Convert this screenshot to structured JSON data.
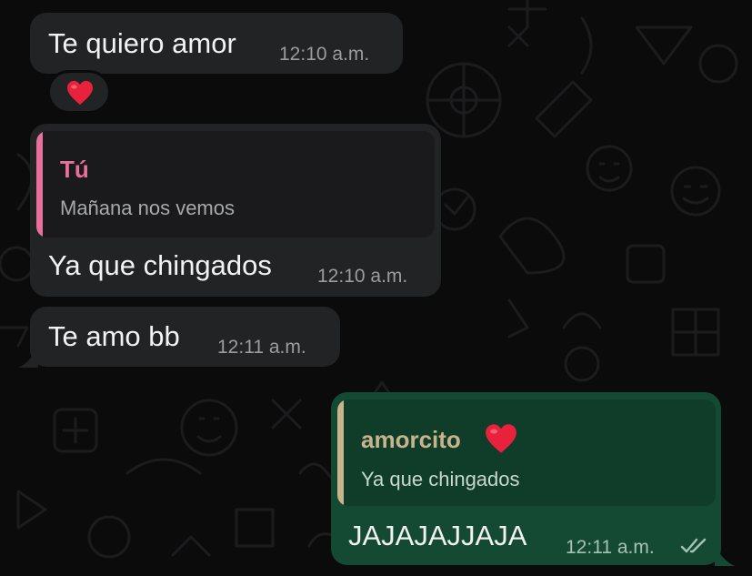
{
  "colors": {
    "background": "#0b0b0c",
    "incoming_bubble": "#222325",
    "outgoing_bubble": "#144a33",
    "quote_incoming_bg": "#1a1a1c",
    "quote_outgoing_bg": "#0f3d29",
    "quote_incoming_accent": "#e8709c",
    "quote_outgoing_accent": "#c8b48a",
    "heart": "#e8213c"
  },
  "messages": [
    {
      "id": "m1",
      "direction": "incoming",
      "text": "Te quiero amor",
      "time": "12:10 a.m.",
      "reaction": {
        "emoji_icon": "red-heart-icon"
      }
    },
    {
      "id": "m2",
      "direction": "incoming",
      "reply_to": {
        "author": "Tú",
        "text": "Mañana nos vemos"
      },
      "text": "Ya que chingados",
      "time": "12:10 a.m."
    },
    {
      "id": "m3",
      "direction": "incoming",
      "text": "Te amo bb",
      "time": "12:11 a.m."
    },
    {
      "id": "m4",
      "direction": "outgoing",
      "reply_to": {
        "author": "amorcito",
        "author_emoji_icon": "red-heart-icon",
        "text": "Ya que chingados"
      },
      "text": "JAJAJAJJAJA",
      "time": "12:11 a.m.",
      "status_icon": "double-check-icon"
    }
  ]
}
